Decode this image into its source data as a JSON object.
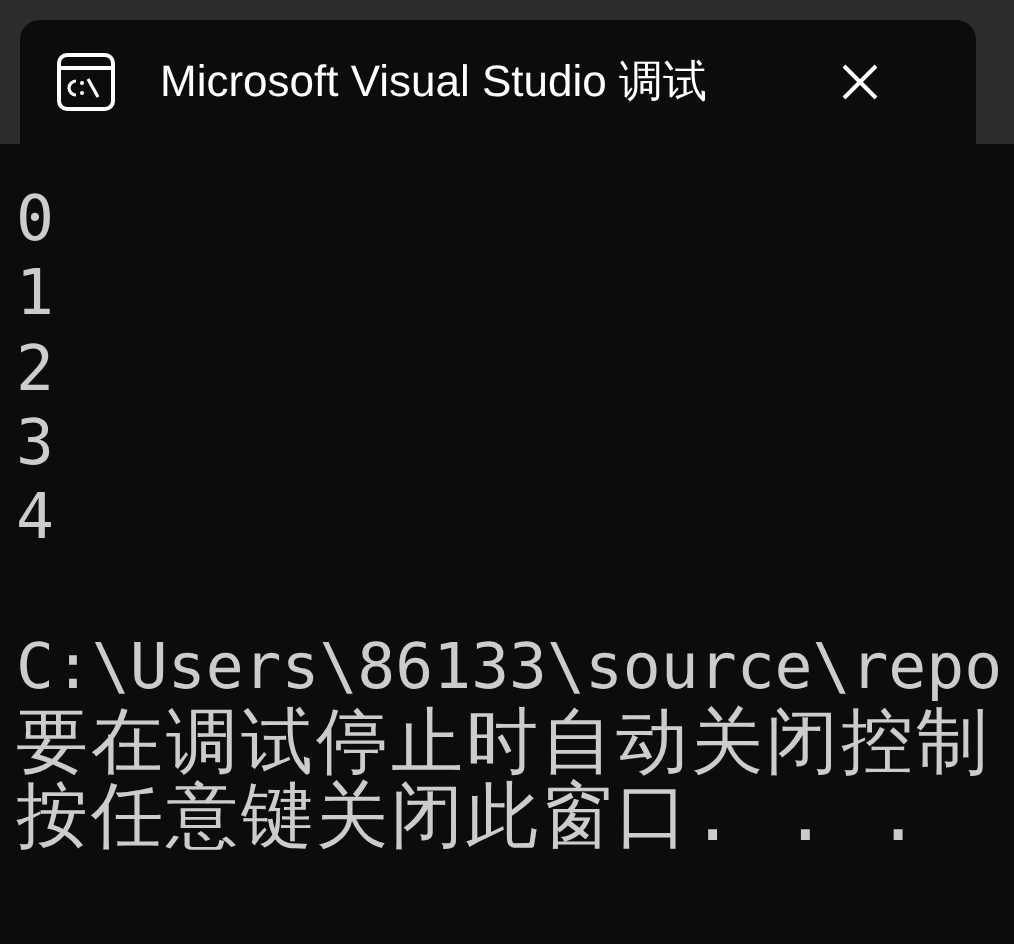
{
  "window": {
    "title": "Microsoft Visual Studio 调试"
  },
  "console": {
    "output": [
      "0",
      "1",
      "2",
      "3",
      "4"
    ],
    "messages": [
      "C:\\Users\\86133\\source\\repo",
      "要在调试停止时自动关闭控制",
      "按任意键关闭此窗口. . ."
    ]
  }
}
